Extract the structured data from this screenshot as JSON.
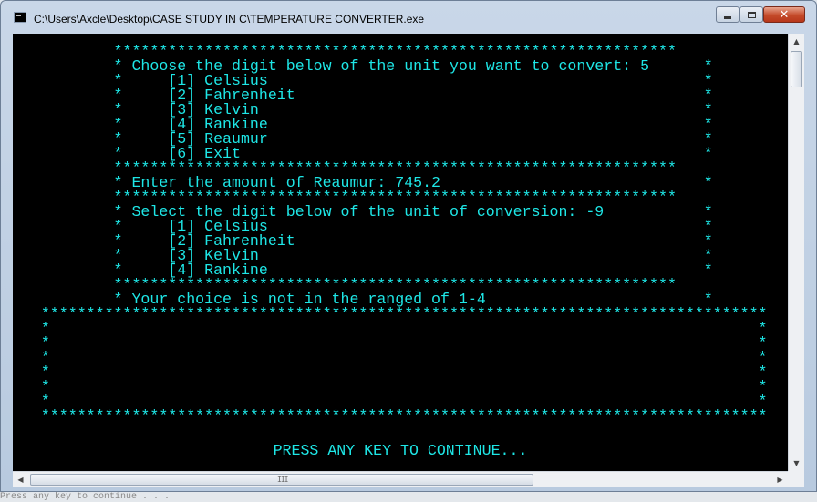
{
  "window": {
    "title": "C:\\Users\\Axcle\\Desktop\\CASE STUDY IN C\\TEMPERATURE CONVERTER.exe",
    "minimize_glyph": "",
    "maximize_glyph": "",
    "close_glyph": "✕"
  },
  "console": {
    "lines": [
      "           **************************************************************",
      "           * Choose the digit below of the unit you want to convert: 5      *",
      "           *     [1] Celsius                                                *",
      "           *     [2] Fahrenheit                                             *",
      "           *     [3] Kelvin                                                 *",
      "           *     [4] Rankine                                                *",
      "           *     [5] Reaumur                                                *",
      "           *     [6] Exit                                                   *",
      "           **************************************************************",
      "           * Enter the amount of Reaumur: 745.2                             *",
      "           **************************************************************",
      "           * Select the digit below of the unit of conversion: -9           *",
      "           *     [1] Celsius                                                *",
      "           *     [2] Fahrenheit                                             *",
      "           *     [3] Kelvin                                                 *",
      "           *     [4] Rankine                                                *",
      "           **************************************************************",
      "           * Your choice is not in the ranged of 1-4                        *",
      "   ********************************************************************************",
      "   *                                                                              *",
      "   *                                                                              *",
      "   *                                                                              *",
      "   *                                                                              *",
      "   *                                                                              *",
      "   *                                                                              *",
      "   ********************************************************************************"
    ],
    "continue_prompt": "PRESS ANY KEY TO CONTINUE..."
  },
  "scrollbars": {
    "up_arrow": "▲",
    "down_arrow": "▼",
    "left_arrow": "◀",
    "right_arrow": "▶",
    "grip": "III"
  },
  "background_text": "Press any key to continue . . .",
  "colors": {
    "console_bg": "#000000",
    "console_text": "#1ee6e6"
  }
}
